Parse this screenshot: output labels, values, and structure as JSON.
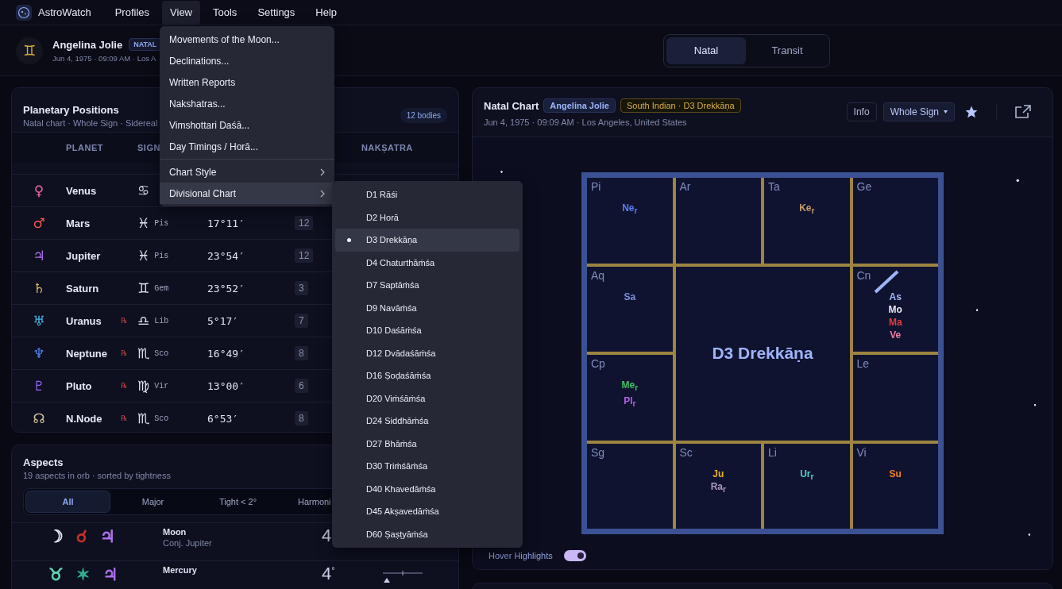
{
  "app": {
    "name": "AstroWatch"
  },
  "menu_bar": [
    {
      "label": "Profiles",
      "selected": false
    },
    {
      "label": "View",
      "selected": true
    },
    {
      "label": "Tools",
      "selected": false
    },
    {
      "label": "Settings",
      "selected": false
    },
    {
      "label": "Help",
      "selected": false
    }
  ],
  "profile": {
    "avatar_glyph": "♊",
    "name": "Angelina Jolie",
    "badge": "NATAL",
    "details": "Jun 4, 1975 · 09:09 AM · Los A"
  },
  "mode_tabs": [
    {
      "label": "Natal",
      "selected": true
    },
    {
      "label": "Transit",
      "selected": false
    }
  ],
  "positions": {
    "title": "Planetary Positions",
    "subtitle": "Natal chart · Whole Sign · Sidereal",
    "count": "12 bodies",
    "columns": [
      "PLANET",
      "SIGN",
      "NAKṢATRA"
    ],
    "rows": [
      {
        "glyph": "♀",
        "color": "#f06aa0",
        "name": "Venus",
        "sign_glyph": "♋"
      },
      {
        "glyph": "♂",
        "color": "#f05a50",
        "name": "Mars",
        "sign_glyph": "♓",
        "sign": "Pis",
        "degree": "17°11′",
        "house": "12"
      },
      {
        "glyph": "♃",
        "color": "#b070f0",
        "name": "Jupiter",
        "sign_glyph": "♓",
        "sign": "Pis",
        "degree": "23°54′",
        "house": "12"
      },
      {
        "glyph": "♄",
        "color": "#d8b860",
        "name": "Saturn",
        "sign_glyph": "♊",
        "sign": "Gem",
        "degree": "23°52′",
        "house": "3"
      },
      {
        "glyph": "♅",
        "color": "#40b8e8",
        "name": "Uranus",
        "retrograde": "℞",
        "sign_glyph": "♎",
        "sign": "Lib",
        "degree": "5°17′",
        "house": "7"
      },
      {
        "glyph": "♆",
        "color": "#5088f0",
        "name": "Neptune",
        "retrograde": "℞",
        "sign_glyph": "♏",
        "sign": "Sco",
        "degree": "16°49′",
        "house": "8"
      },
      {
        "glyph": "♇",
        "color": "#9068f0",
        "name": "Pluto",
        "retrograde": "℞",
        "sign_glyph": "♍",
        "sign": "Vir",
        "degree": "13°00′",
        "house": "6"
      },
      {
        "glyph": "☊",
        "color": "#d0c098",
        "name": "N.Node",
        "retrograde": "℞",
        "sign_glyph": "♏",
        "sign": "Sco",
        "degree": "6°53′",
        "house": "8"
      }
    ]
  },
  "aspects": {
    "title": "Aspects",
    "subtitle": "19 aspects in orb · sorted by tightness",
    "filters": [
      {
        "label": "All",
        "selected": true
      },
      {
        "label": "Major",
        "selected": false
      },
      {
        "label": "Tight < 2°",
        "selected": false
      },
      {
        "label": "Harmoni",
        "selected": false
      }
    ],
    "rows": [
      {
        "glyphs": [
          {
            "text": "☽",
            "color": "#e4e6f4"
          },
          {
            "text": "☌",
            "color": "#c83028"
          },
          {
            "text": "♃",
            "color": "#b070f0"
          }
        ],
        "planet": "Moon",
        "detail": "Conj.  Jupiter",
        "orb": "4"
      },
      {
        "glyphs": [
          {
            "text": "♉",
            "color": "#60d8b0"
          },
          {
            "text": "✶",
            "color": "#30b090"
          },
          {
            "text": "♃",
            "color": "#b070f0"
          }
        ],
        "planet": "Mercury",
        "orb": "4$^{°}$",
        "meter": true
      }
    ]
  },
  "chart": {
    "title": "Natal Chart",
    "badges": [
      {
        "text": "Angelina Jolie",
        "kind": "name"
      },
      {
        "text": "South Indian · D3 Drekkāṇa",
        "kind": "style"
      }
    ],
    "details": "Jun 4, 1975 · 09:09 AM · Los Angeles, United States",
    "info_button": "Info",
    "house_system": "Whole Sign",
    "center_label": "D3 Drekkāṇa",
    "cells": [
      {
        "label": "Pi",
        "planets": [
          {
            "text": "Ne$_{r}$",
            "color": "#5b7ef2"
          }
        ]
      },
      {
        "label": "Ar"
      },
      {
        "label": "Ta",
        "planets": [
          {
            "text": "Ke$_{r}$",
            "color": "#c49a6c"
          }
        ]
      },
      {
        "label": "Ge"
      },
      {
        "label": "Aq",
        "planets": [
          {
            "text": "Sa",
            "color": "#7d90e2"
          }
        ]
      },
      {
        "label": "Cn",
        "ascendant": true,
        "planets": [
          {
            "text": "As",
            "color": "#a4b6f6"
          },
          {
            "text": "Mo",
            "color": "#e8e8f0"
          },
          {
            "text": "Ma",
            "color": "#e23c3c"
          },
          {
            "text": "Ve",
            "color": "#f07ca2"
          }
        ]
      },
      {
        "label": "Cp",
        "planets": [
          {
            "text": "Me$_{r}$",
            "color": "#3cc060"
          },
          {
            "text": "Pl$_{r}$",
            "color": "#b462e2"
          }
        ]
      },
      {
        "label": "Le"
      },
      {
        "label": "Sg"
      },
      {
        "label": "Sc",
        "planets": [
          {
            "text": "Ju",
            "color": "#e8b020"
          },
          {
            "text": "Ra$_{r}$",
            "color": "#a898b8"
          }
        ]
      },
      {
        "label": "Li",
        "planets": [
          {
            "text": "Ur$_{r}$",
            "color": "#50d0c0"
          }
        ]
      },
      {
        "label": "Vi",
        "planets": [
          {
            "text": "Su",
            "color": "#f08020"
          }
        ]
      }
    ],
    "hover_toggle": {
      "label": "Hover Highlights",
      "on": true
    }
  },
  "view_menu": [
    {
      "label": "Movements of the Moon..."
    },
    {
      "label": "Declinations..."
    },
    {
      "label": "Written Reports"
    },
    {
      "label": "Nakshatras..."
    },
    {
      "label": "Vimshottari Daśā..."
    },
    {
      "label": "Day Timings / Horā..."
    },
    {
      "label": "Chart Style",
      "separator_before": true,
      "submenu": true,
      "expanded": false
    },
    {
      "label": "Divisional Chart",
      "submenu": true,
      "expanded": true
    }
  ],
  "divisional_menu": [
    {
      "label": "D1 Rāśi",
      "selected": false
    },
    {
      "label": "D2 Horā",
      "selected": false
    },
    {
      "label": "D3 Drekkāṇa",
      "selected": true
    },
    {
      "label": "D4 Chaturthāṁśa",
      "selected": false
    },
    {
      "label": "D7 Saptāṁśa",
      "selected": false
    },
    {
      "label": "D9 Navāṁśa",
      "selected": false
    },
    {
      "label": "D10 Daśāṁśa",
      "selected": false
    },
    {
      "label": "D12 Dvādaśāṁśa",
      "selected": false
    },
    {
      "label": "D16 Ṣoḍaśāṁśa",
      "selected": false
    },
    {
      "label": "D20 Viṁśāṁśa",
      "selected": false
    },
    {
      "label": "D24 Siddhāṁśa",
      "selected": false
    },
    {
      "label": "D27 Bhāṁśa",
      "selected": false
    },
    {
      "label": "D30 Triṁśāṁśa",
      "selected": false
    },
    {
      "label": "D40 Khavedāṁśa",
      "selected": false
    },
    {
      "label": "D45 Akṣavedāṁśa",
      "selected": false
    },
    {
      "label": "D60 Ṣaṣṭyāṁśa",
      "selected": false
    }
  ]
}
